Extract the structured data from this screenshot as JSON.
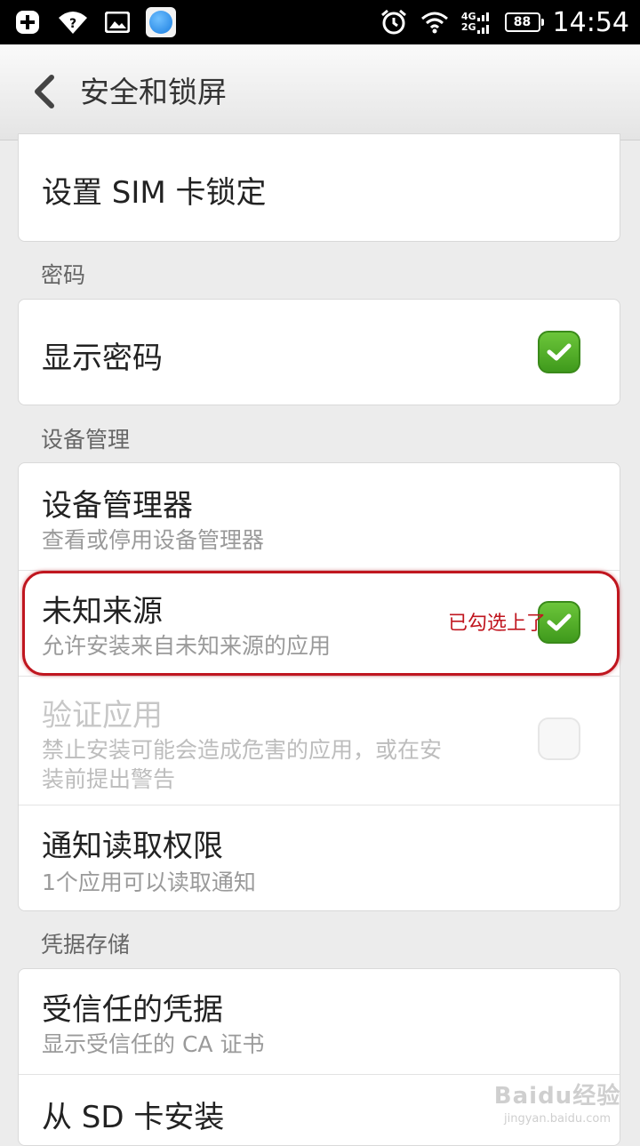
{
  "status_bar": {
    "net_top": "4G",
    "net_bottom": "2G",
    "battery": "88",
    "time": "14:54",
    "icons": [
      "add-icon",
      "wifi-question-icon",
      "image-icon",
      "app-icon",
      "alarm-icon",
      "wifi-icon",
      "signal-icon",
      "battery-icon"
    ]
  },
  "header": {
    "title": "安全和锁屏",
    "back_icon": "chevron-left-icon"
  },
  "sim_lock": {
    "title": "设置 SIM 卡锁定"
  },
  "password_section": {
    "header": "密码",
    "show_password": {
      "title": "显示密码",
      "checked": true
    }
  },
  "device_section": {
    "header": "设备管理",
    "device_admin": {
      "title": "设备管理器",
      "subtitle": "查看或停用设备管理器"
    },
    "unknown_sources": {
      "title": "未知来源",
      "subtitle": "允许安装来自未知来源的应用",
      "checked": true
    },
    "verify_apps": {
      "title": "验证应用",
      "subtitle_line1": "禁止安装可能会造成危害的应用，或在安",
      "subtitle_line2": "装前提出警告",
      "checked": false,
      "disabled": true
    },
    "notification_access": {
      "title": "通知读取权限",
      "subtitle": "1个应用可以读取通知"
    }
  },
  "credential_section": {
    "header": "凭据存储",
    "trusted": {
      "title": "受信任的凭据",
      "subtitle": "显示受信任的 CA 证书"
    },
    "install_sd": {
      "title": "从 SD 卡安装"
    }
  },
  "annotation": {
    "text": "已勾选上了",
    "color": "#c0161f"
  },
  "watermark": {
    "brand": "Baidu经验",
    "url": "jingyan.baidu.com"
  },
  "colors": {
    "checkbox_green": "#4caf24",
    "annotation_red": "#c0161f"
  }
}
